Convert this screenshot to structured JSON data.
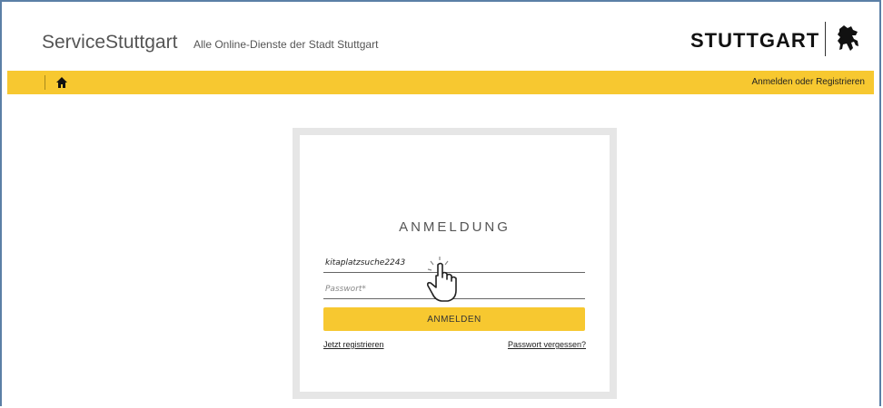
{
  "header": {
    "brand": "ServiceStuttgart",
    "tagline": "Alle Online-Dienste der Stadt Stuttgart",
    "city_logo_text": "STUTTGART"
  },
  "navbar": {
    "home_icon": "home-icon",
    "login_link": "Anmelden oder Registrieren",
    "background": "#f7c830"
  },
  "login": {
    "title": "ANMELDUNG",
    "username_value": "kitaplatzsuche2243",
    "password_placeholder": "Passwort*",
    "submit_label": "ANMELDEN",
    "register_link": "Jetzt registrieren",
    "forgot_link": "Passwort vergessen?"
  },
  "colors": {
    "accent": "#f7c830",
    "text": "#555555"
  }
}
